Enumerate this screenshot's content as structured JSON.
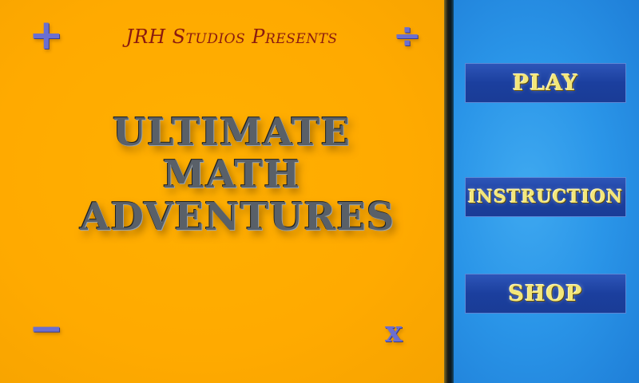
{
  "header": {
    "presents": "JRH Studios Presents"
  },
  "title": {
    "line1": "ULTIMATE",
    "line2": "MATH",
    "line3": "ADVENTURES"
  },
  "symbols": {
    "plus": "+",
    "divide": "÷",
    "minus": "−",
    "times": "x"
  },
  "menu": {
    "play": "PLAY",
    "instruction": "INSTRUCTION",
    "shop": "SHOP"
  },
  "colors": {
    "left_panel": "#ffaa00",
    "right_panel": "#2a95e8",
    "button": "#1b3f9e",
    "button_text": "#f3e77a",
    "presents_text": "#8a1a10"
  }
}
